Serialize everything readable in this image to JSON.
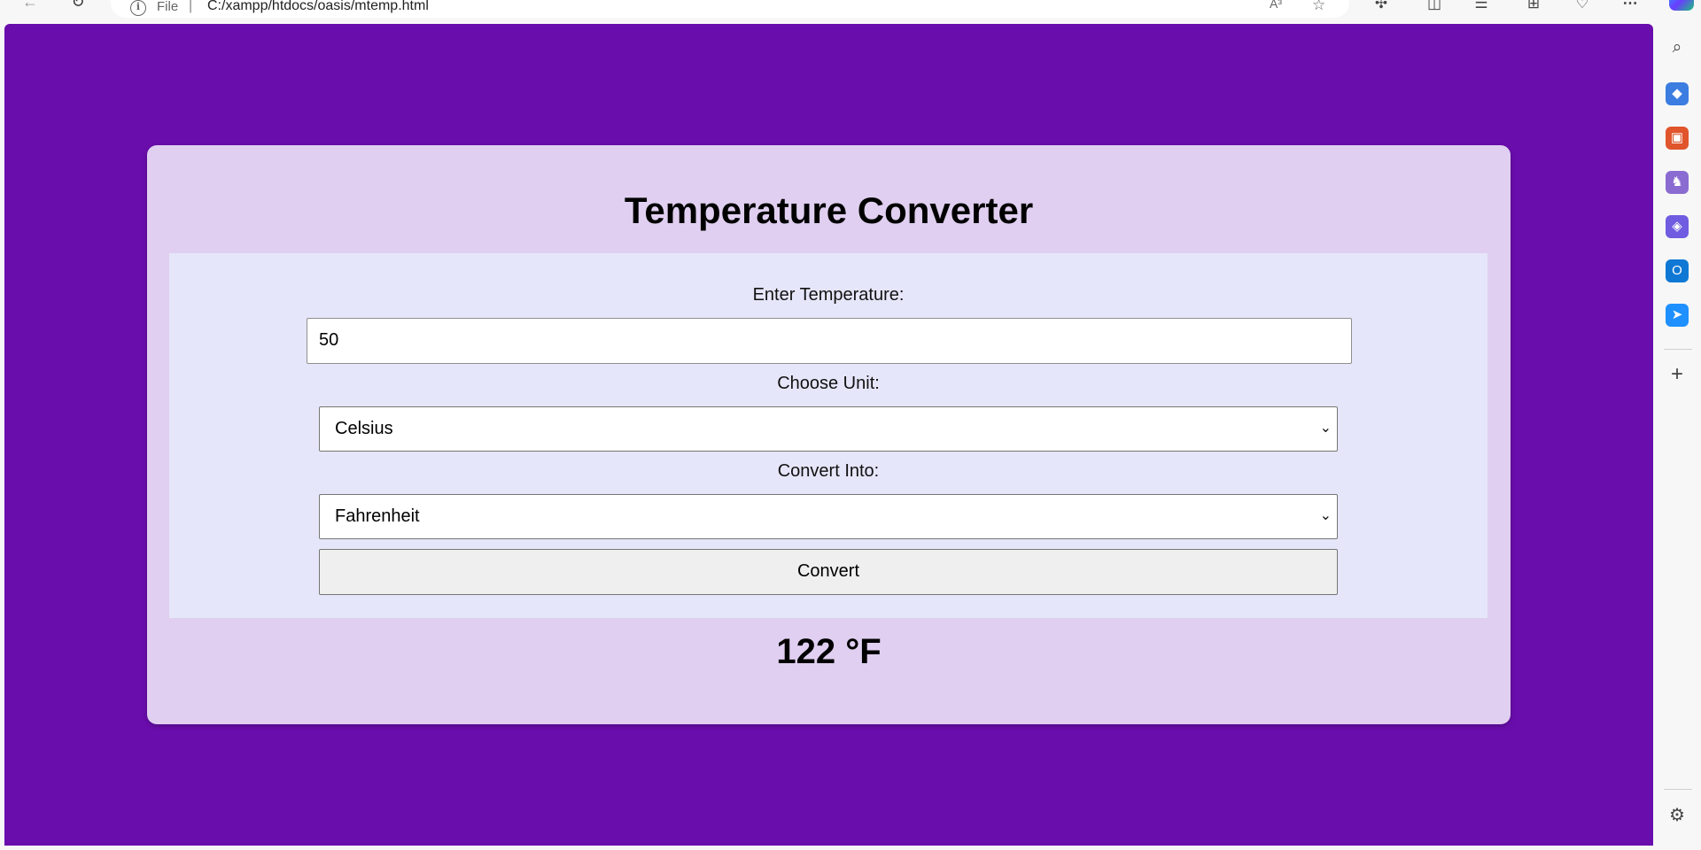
{
  "browser": {
    "scheme_label": "File",
    "separator": "|",
    "url": "C:/xampp/htdocs/oasis/mtemp.html",
    "read_aloud_label": "A³",
    "info_glyph": "i"
  },
  "page": {
    "title": "Temperature Converter",
    "temperature_label": "Enter Temperature:",
    "temperature_value": "50",
    "unit_label": "Choose Unit:",
    "unit_selected": "Celsius",
    "convert_into_label": "Convert Into:",
    "convert_into_selected": "Fahrenheit",
    "convert_button": "Convert",
    "result": "122 °F"
  },
  "colors": {
    "background": "#6a0dad",
    "card": "#e0cff0",
    "form_panel": "#e6e6fa"
  },
  "sidebar": {
    "icons": [
      "search-icon",
      "tag-icon",
      "toolbox-icon",
      "games-icon",
      "microsoft365-icon",
      "outlook-icon",
      "send-icon",
      "add-icon",
      "settings-icon"
    ]
  }
}
